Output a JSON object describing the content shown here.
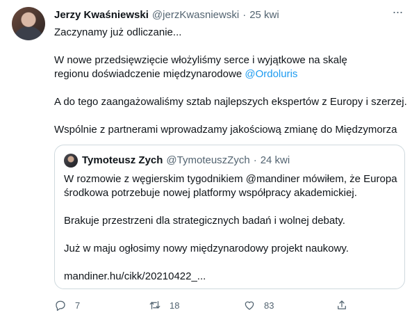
{
  "tweet": {
    "author_name": "Jerzy Kwaśniewski",
    "author_handle": "@jerzKwasniewski",
    "separator": "·",
    "time": "25 kwi",
    "more_glyph": "···",
    "lines": {
      "l1": "Zaczynamy już odliczanie...",
      "l2": "W nowe przedsięwzięcie włożyliśmy serce i wyjątkowe na skalę",
      "l3": "regionu doświadczenie międzynarodowe ",
      "l3_mention": "@Ordoluris",
      "l4": "A do tego zaangażowaliśmy sztab najlepszych ekspertów z Europy i szerzej.",
      "l5": "Wspólnie z partnerami wprowadzamy jakościową zmianę do Międzymorza"
    }
  },
  "quote": {
    "author_name": "Tymoteusz Zych",
    "author_handle": "@TymoteuszZych",
    "separator": "·",
    "time": "24 kwi",
    "lines": {
      "l1": "W rozmowie z węgierskim tygodnikiem @mandiner mówiłem, że Europa",
      "l2": "środkowa potrzebuje nowej platformy współpracy akademickiej.",
      "l3": "Brakuje przestrzeni dla strategicznych badań i wolnej debaty.",
      "l4": "Już w maju ogłosimy nowy międzynarodowy projekt naukowy.",
      "l5": "mandiner.hu/cikk/20210422_..."
    }
  },
  "actions": {
    "reply_count": "7",
    "retweet_count": "18",
    "like_count": "83",
    "icons": [
      "reply-icon",
      "retweet-icon",
      "like-icon",
      "share-icon"
    ]
  },
  "colors": {
    "text": "#0f1419",
    "secondary": "#536471",
    "link": "#1d9bf0",
    "border": "#cfd9de"
  }
}
